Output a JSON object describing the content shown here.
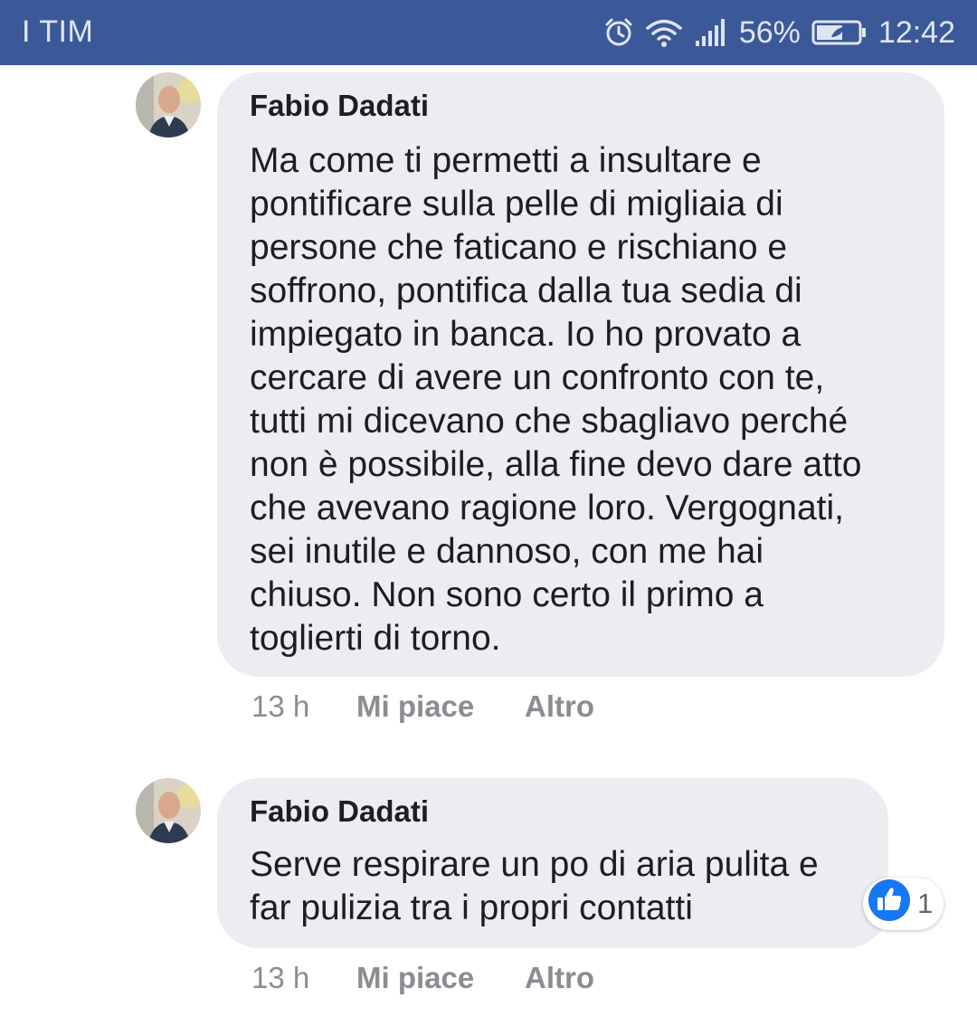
{
  "status_bar": {
    "carrier": "I TIM",
    "battery_percent": "56%",
    "time": "12:42"
  },
  "comments": [
    {
      "author": "Fabio Dadati",
      "text": "Ma come ti permetti a insultare e\npontificare sulla pelle di migliaia di\npersone che faticano e rischiano e\nsoffrono, pontifica dalla tua sedia di\nimpiegato in banca. Io ho provato a\ncercare di avere un confronto con te,\ntutti mi dicevano che sbagliavo perché\nnon è possibile, alla fine devo dare atto\nche avevano ragione loro. Vergognati,\nsei inutile e dannoso, con me hai\nchiuso. Non sono certo il primo a\ntoglierti di torno.",
      "time": "13 h",
      "like_label": "Mi piace",
      "more_label": "Altro"
    },
    {
      "author": "Fabio Dadati",
      "text": "Serve respirare un po di aria pulita e\nfar pulizia tra i propri contatti",
      "time": "13 h",
      "like_label": "Mi piace",
      "more_label": "Altro",
      "reaction_icon": "like-thumb-icon",
      "reaction_count": "1"
    }
  ],
  "colors": {
    "status_bar": "#3b5998",
    "bubble": "#ebedf0",
    "like_blue": "#1877f2",
    "meta_gray": "#8a8d91"
  }
}
